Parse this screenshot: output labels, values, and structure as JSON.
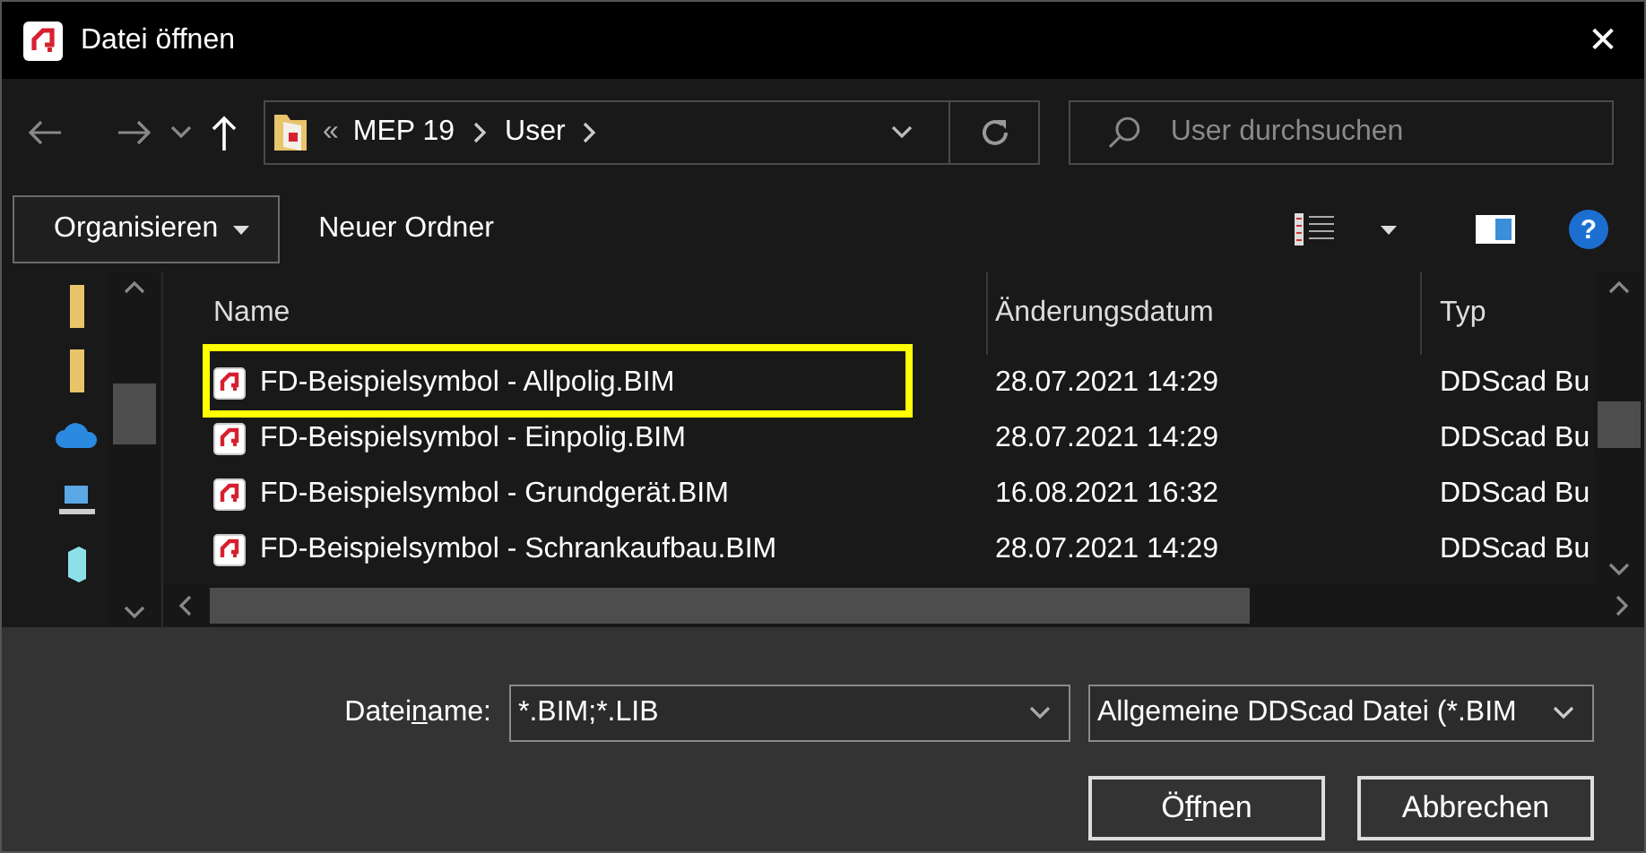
{
  "window": {
    "title": "Datei öffnen",
    "close": "✕"
  },
  "navigation": {
    "path": [
      "MEP 19",
      "User"
    ],
    "overflow": "«",
    "search_placeholder": "User durchsuchen"
  },
  "toolbar": {
    "organize": "Organisieren",
    "new_folder": "Neuer Ordner",
    "help": "?"
  },
  "sidebar": {
    "items": [
      {
        "kind": "folder"
      },
      {
        "kind": "folder"
      },
      {
        "kind": "cloud"
      },
      {
        "kind": "computer"
      },
      {
        "kind": "cube"
      }
    ]
  },
  "table": {
    "columns": [
      "Name",
      "Änderungsdatum",
      "Typ"
    ],
    "rows": [
      {
        "name": "FD-Beispielsymbol - Allpolig.BIM",
        "date": "28.07.2021 14:29",
        "type": "DDScad Bu",
        "highlighted": true
      },
      {
        "name": "FD-Beispielsymbol - Einpolig.BIM",
        "date": "28.07.2021 14:29",
        "type": "DDScad Bu",
        "highlighted": false
      },
      {
        "name": "FD-Beispielsymbol - Grundgerät.BIM",
        "date": "16.08.2021 16:32",
        "type": "DDScad Bu",
        "highlighted": false
      },
      {
        "name": "FD-Beispielsymbol - Schrankaufbau.BIM",
        "date": "28.07.2021 14:29",
        "type": "DDScad Bu",
        "highlighted": false
      }
    ]
  },
  "footer": {
    "filename_label": {
      "before": "Datei",
      "key": "n",
      "after": "ame:"
    },
    "filename_value": "*.BIM;*.LIB",
    "filetype": "Allgemeine DDScad Datei (*.BIM",
    "open_button": {
      "before": "Ö",
      "key": "f",
      "after": "fnen"
    },
    "cancel_button": "Abbrechen"
  }
}
